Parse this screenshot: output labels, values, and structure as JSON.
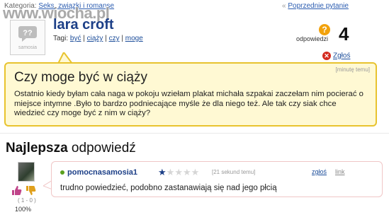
{
  "topbar": {
    "category_label": "Kategoria:",
    "category_link": "Seks, związki i romanse",
    "prev_prefix": "«",
    "prev_link": "Poprzednie pytanie",
    "watermark": "www.wiocha.pl"
  },
  "user": {
    "avatar_caption": "samosia",
    "name": "lara croft",
    "tags_label": "Tagi:",
    "tags": [
      "być",
      "ciąży",
      "czy",
      "moge"
    ]
  },
  "answers": {
    "badge": "?",
    "label": "odpowiedzi",
    "count": "4"
  },
  "report": {
    "label": "Zgłoś",
    "icon": "x-icon"
  },
  "question": {
    "time": "[minutę temu]",
    "title": "Czy moge być w ciąży",
    "body": "Ostatnio kiedy byłam cała naga w pokoju wziełam plakat michała szpakai zaczełam nim pocierać o miejsce intymne .Było to bardzo podniecające myśle że dla niego też. Ale tak czy siak chce wiedzieć czy moge być z nim w ciąży?"
  },
  "best_answer": {
    "header_bold": "Najlepsza",
    "header_rest": " odpowiedź",
    "author": "pomocnasamosia1",
    "rating": 1,
    "rating_max": 5,
    "time": "[21 sekund temu]",
    "report": "zgłoś",
    "link": "link",
    "text": "trudno powiedzieć, podobno zastanawiają się nad jego płcią",
    "votes": "( 1 - 0 )",
    "percent": "100%"
  },
  "colors": {
    "link": "#1c4d9a",
    "question_bg": "#fff9d3",
    "question_border": "#e8c32e",
    "answer_border": "#f0c6c6",
    "badge": "#f2a20c",
    "report": "#d42a1f"
  }
}
